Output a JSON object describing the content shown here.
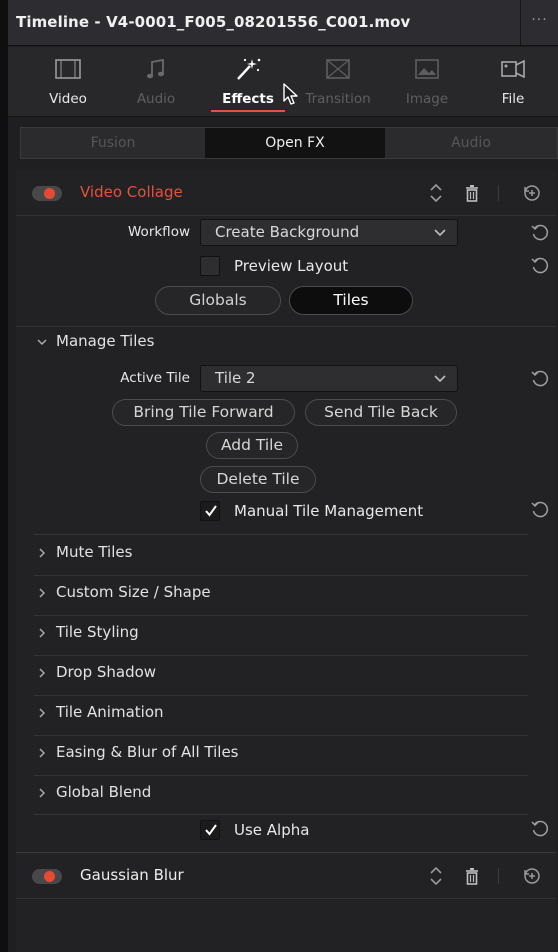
{
  "window": {
    "title": "Timeline - V4-0001_F005_08201556_C001.mov",
    "more": "···"
  },
  "inspector_tabs": [
    {
      "label": "Video",
      "icon": "video-icon",
      "state": "normal"
    },
    {
      "label": "Audio",
      "icon": "audio-icon",
      "state": "dim"
    },
    {
      "label": "Effects",
      "icon": "effects-wand-icon",
      "state": "active"
    },
    {
      "label": "Transition",
      "icon": "transition-icon",
      "state": "dim"
    },
    {
      "label": "Image",
      "icon": "image-icon",
      "state": "dim"
    },
    {
      "label": "File",
      "icon": "file-icon",
      "state": "normal"
    }
  ],
  "subtabs": [
    {
      "label": "Fusion",
      "active": false
    },
    {
      "label": "Open FX",
      "active": true
    },
    {
      "label": "Audio",
      "active": false
    }
  ],
  "effects": [
    {
      "name": "Video Collage",
      "enabled": true,
      "workflow_label": "Workflow",
      "workflow_value": "Create Background",
      "preview_layout_label": "Preview Layout",
      "preview_layout_checked": false,
      "segments": [
        {
          "label": "Globals",
          "active": false
        },
        {
          "label": "Tiles",
          "active": true
        }
      ],
      "manage_tiles": {
        "label": "Manage Tiles",
        "expanded": true,
        "active_tile_label": "Active Tile",
        "active_tile_value": "Tile 2",
        "bring_forward": "Bring Tile Forward",
        "send_back": "Send Tile Back",
        "add_tile": "Add Tile",
        "delete_tile": "Delete Tile",
        "manual_mgmt_label": "Manual Tile Management",
        "manual_mgmt_checked": true
      },
      "sections": [
        "Mute Tiles",
        "Custom Size / Shape",
        "Tile Styling",
        "Drop Shadow",
        "Tile Animation",
        "Easing & Blur of All Tiles",
        "Global Blend"
      ],
      "use_alpha_label": "Use Alpha",
      "use_alpha_checked": true
    },
    {
      "name": "Gaussian Blur",
      "enabled": true
    }
  ],
  "colors": {
    "accent": "#e5513c",
    "panel_bg": "#222224",
    "titlebar_bg": "#2d2d31"
  }
}
